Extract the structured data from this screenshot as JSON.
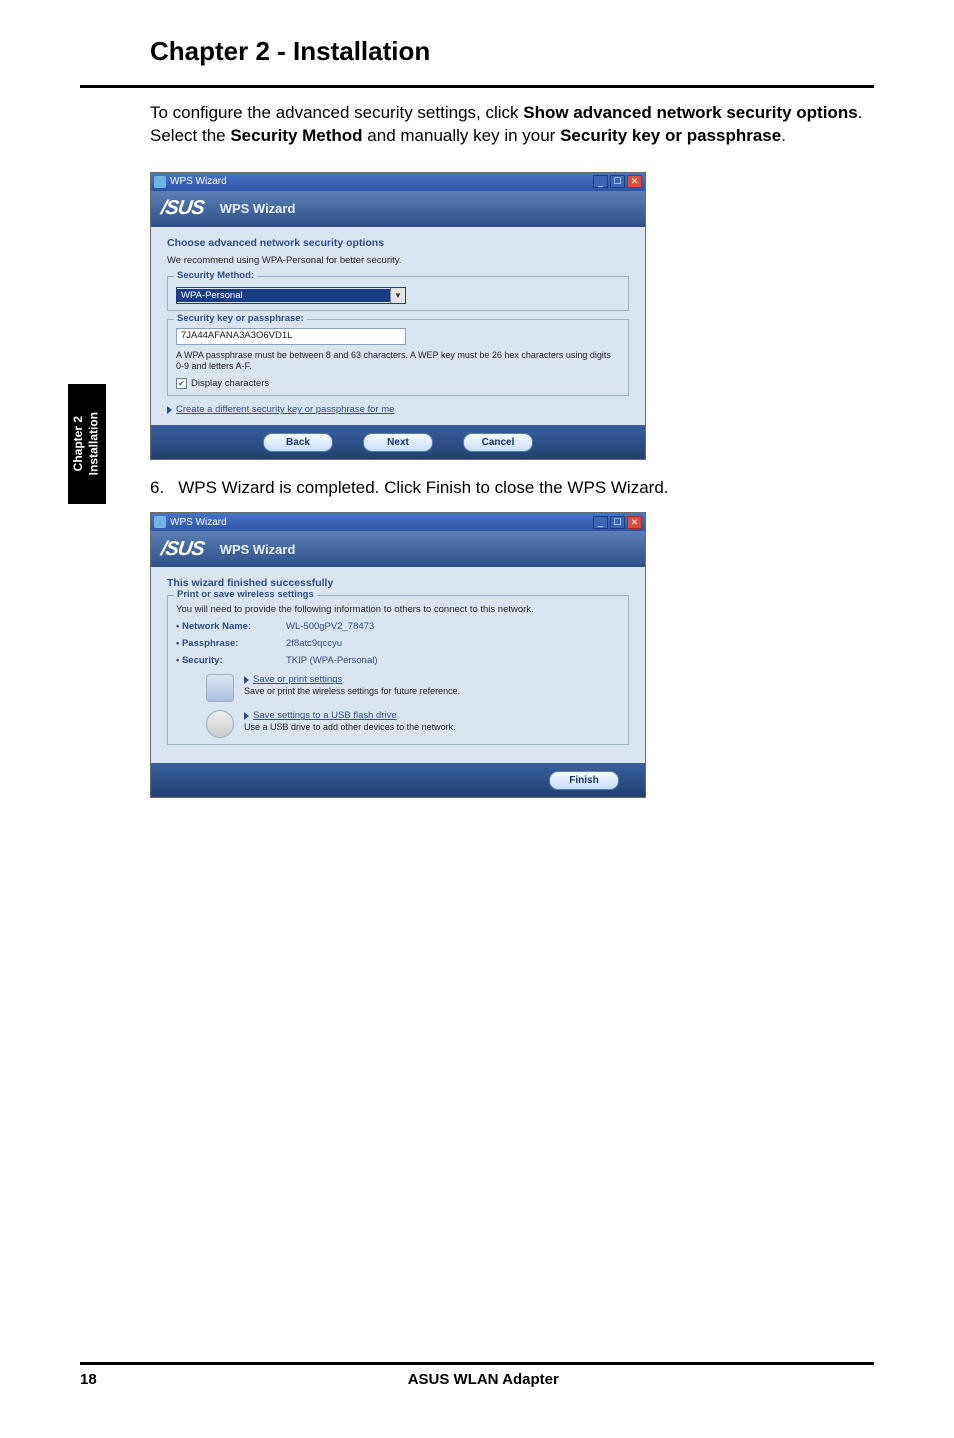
{
  "chapter_title": "Chapter 2 - Installation",
  "side_tab": "Chapter 2\nInstallation",
  "intro": {
    "pre": "To configure the advanced security settings, click ",
    "b1": "Show advanced network security options",
    "mid1": ". Select the ",
    "b2": "Security Method",
    "mid2": " and manually key in your ",
    "b3": "Security key or passphrase",
    "end": "."
  },
  "shot1": {
    "titlebar": "WPS Wizard",
    "logo": "/SUS",
    "banner": "WPS Wizard",
    "heading": "Choose advanced network security options",
    "note": "We recommend using WPA-Personal for better security.",
    "fs1_legend": "Security Method:",
    "dropdown_value": "WPA-Personal",
    "fs2_legend": "Security key or passphrase:",
    "passphrase_value": "7JA44AFANA3A3O6VD1L",
    "passphrase_hint": "A WPA passphrase must be between 8 and 63 characters. A WEP key must be 26 hex characters using digits 0-9 and letters A-F.",
    "display_chars": "Display characters",
    "gen_link": "Create a different security key or passphrase for me",
    "btn_back": "Back",
    "btn_next": "Next",
    "btn_cancel": "Cancel"
  },
  "step6": {
    "num": "6.",
    "text_pre": "WPS Wizard is completed. Click ",
    "b": "Finish",
    "text_post": " to close the WPS Wizard."
  },
  "shot2": {
    "titlebar": "WPS Wizard",
    "logo": "/SUS",
    "banner": "WPS Wizard",
    "heading": "This wizard finished successfully",
    "fs_legend": "Print or save wireless settings",
    "fs_note": "You will need to provide the following information to others to connect to this network.",
    "k_net": "• Network Name:",
    "v_net": "WL-500gPV2_78473",
    "k_pass": "• Passphrase:",
    "v_pass": "2f8atc9qccyu",
    "k_sec": "• Security:",
    "v_sec": "TKIP (WPA-Personal)",
    "save_print_label": "Save or print settings",
    "save_print_sub": "Save or print the wireless settings for future reference.",
    "usb_label": "Save settings to a USB flash drive",
    "usb_sub": "Use a USB drive to add other devices to the network.",
    "btn_finish": "Finish"
  },
  "footer": {
    "page": "18",
    "product": "ASUS WLAN Adapter"
  }
}
